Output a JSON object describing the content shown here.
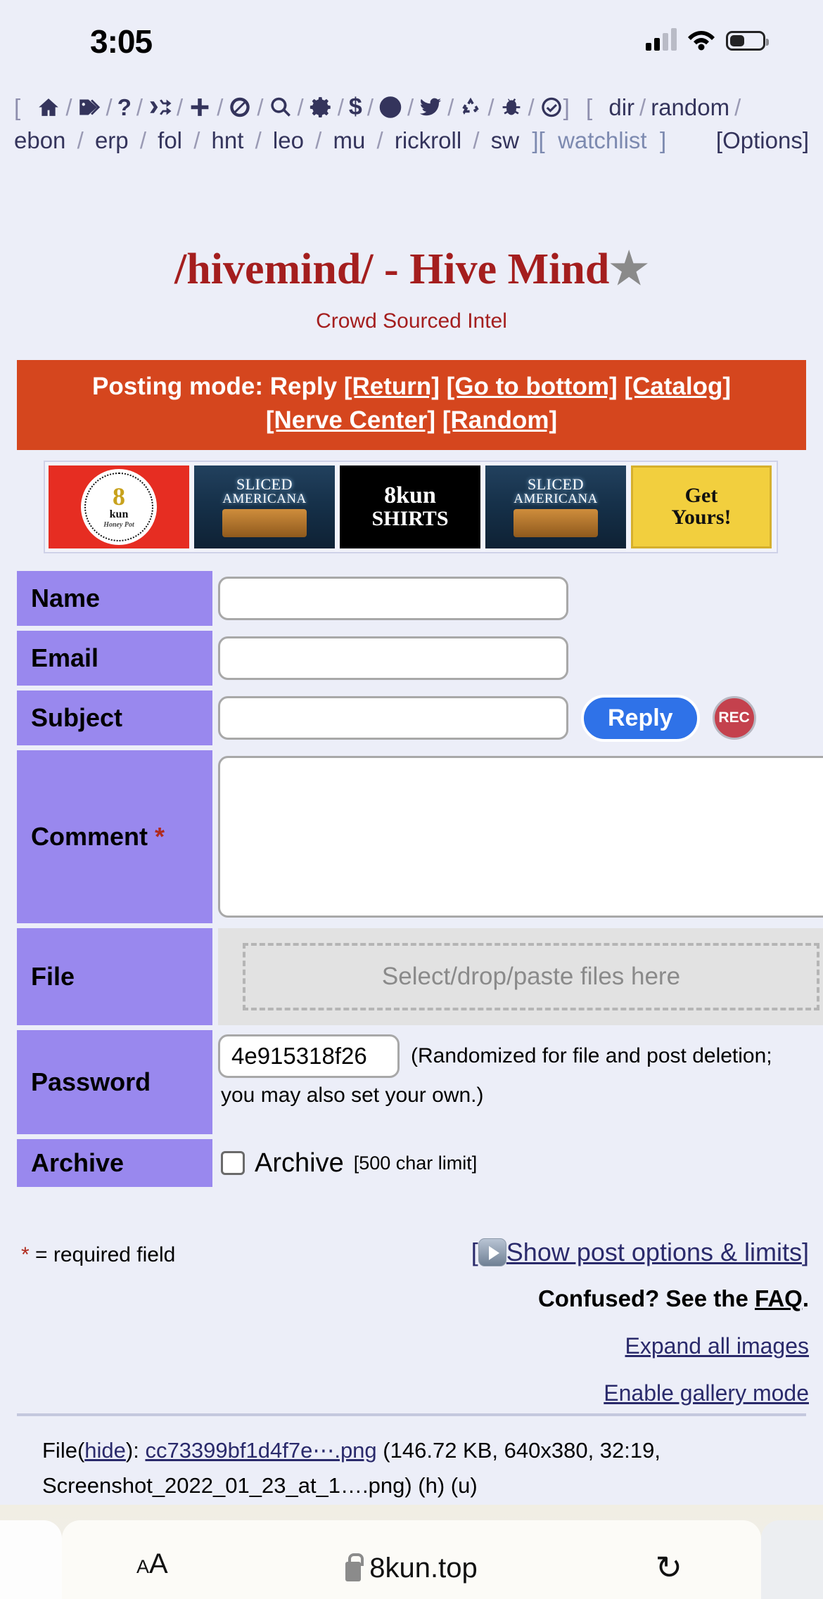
{
  "status_bar": {
    "time": "3:05",
    "icons": [
      "cellular-signal-icon",
      "wifi-icon",
      "battery-icon"
    ]
  },
  "board_nav": {
    "open_bracket": "[",
    "close_bracket": "]",
    "separator": "/",
    "icons": [
      {
        "name": "home-icon",
        "glyph": "home"
      },
      {
        "name": "tags-icon",
        "glyph": "tags"
      },
      {
        "name": "question-icon",
        "glyph": "?"
      },
      {
        "name": "shuffle-icon",
        "glyph": "shuffle"
      },
      {
        "name": "plus-icon",
        "glyph": "plus"
      },
      {
        "name": "ban-icon",
        "glyph": "ban"
      },
      {
        "name": "search-icon",
        "glyph": "search"
      },
      {
        "name": "gear-icon",
        "glyph": "gear"
      },
      {
        "name": "dollar-icon",
        "glyph": "$"
      },
      {
        "name": "adjust-icon",
        "glyph": "adjust"
      },
      {
        "name": "twitter-icon",
        "glyph": "twitter"
      },
      {
        "name": "recycle-icon",
        "glyph": "recycle"
      },
      {
        "name": "bug-icon",
        "glyph": "bug"
      },
      {
        "name": "check-circle-icon",
        "glyph": "check"
      }
    ],
    "groups": [
      "dir",
      "random",
      "ebon",
      "erp",
      "fol",
      "hnt",
      "leo",
      "mu",
      "rickroll",
      "sw"
    ],
    "watchlist": "watchlist",
    "options": "[Options]"
  },
  "board": {
    "title": "/hivemind/ - Hive Mind",
    "star": "★",
    "subtitle": "Crowd Sourced Intel"
  },
  "posting_bar": {
    "prefix": "Posting mode: Reply",
    "links": [
      "[Return]",
      "[Go to bottom]",
      "[Catalog]",
      "[Nerve Center]",
      "[Random]"
    ],
    "background": "#d5461e"
  },
  "banners": [
    {
      "name": "8kun-honey-banner",
      "line1": "8",
      "line2": "kun",
      "line3": "Honey Pot",
      "ring_text": "UNFILTERED RAW • FREE SPEECH HONEY •"
    },
    {
      "name": "sliced-americana-banner-1",
      "line1": "SLICED",
      "line2": "AMERICANA"
    },
    {
      "name": "8kun-shirts-banner",
      "line1": "8kun",
      "line2": "SHIRTS"
    },
    {
      "name": "sliced-americana-banner-2",
      "line1": "SLICED",
      "line2": "AMERICANA"
    },
    {
      "name": "get-yours-banner",
      "line1": "Get",
      "line2": "Yours!"
    }
  ],
  "form": {
    "name_label": "Name",
    "name_value": "",
    "email_label": "Email",
    "email_value": "",
    "subject_label": "Subject",
    "subject_value": "",
    "reply_button": "Reply",
    "rec_button": "REC",
    "comment_label": "Comment",
    "comment_required": "*",
    "comment_value": "",
    "file_label": "File",
    "file_drop_text": "Select/drop/paste files here",
    "password_label": "Password",
    "password_value": "4e915318f26",
    "password_note_line1": "(Randomized for file and post deletion;",
    "password_note_line2": "you may also set your own.)",
    "archive_label": "Archive",
    "archive_checkbox_label": "Archive",
    "archive_limit": "[500 char limit]",
    "archive_checked": false,
    "required_note": "= required field",
    "required_star": "*"
  },
  "footer": {
    "show_post_options": "Show post options & limits",
    "show_post_options_open": "[",
    "show_post_options_close": "]",
    "confused_prefix": "Confused? See the",
    "faq": "FAQ",
    "confused_suffix": ".",
    "expand_all_images": "Expand all images",
    "enable_gallery_mode": "Enable gallery mode"
  },
  "post": {
    "file_prefix": "File",
    "hide_open": "(",
    "hide": "hide",
    "hide_close": "):",
    "filename": "cc73399bf1d4f7e⋯.png",
    "details_line1": "(146.72 KB, 640x380, 32:19,",
    "details_line2": "Screenshot_2022_01_23_at_1….png) (h) (u)"
  },
  "browser": {
    "text_size_button": "AA",
    "lock_icon": "lock-icon",
    "url": "8kun.top",
    "reload_icon": "↻"
  }
}
